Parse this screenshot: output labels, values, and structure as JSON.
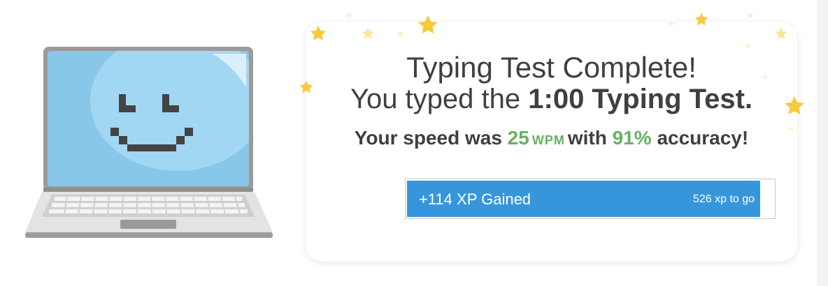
{
  "result": {
    "title": "Typing Test Complete!",
    "subtitle_prefix": "You typed the",
    "subtitle_test": "1:00 Typing Test.",
    "speed_prefix": "Your speed was",
    "wpm_value": "25",
    "wpm_unit": "WPM",
    "speed_middle": "with",
    "accuracy_value": "91%",
    "speed_suffix": "accuracy!"
  },
  "xp": {
    "gained_label": "+114 XP Gained",
    "remaining_label": "526 xp to go",
    "progress_fraction": 0.96
  },
  "colors": {
    "accent_green": "#67b163",
    "xp_blue": "#3796db",
    "text": "#3f3f3f",
    "star_yellow": "#f6ca3a",
    "screen_blue": "#8ccbec"
  },
  "icons": {
    "laptop": "smiling-laptop-icon",
    "stars": "star-icon"
  }
}
